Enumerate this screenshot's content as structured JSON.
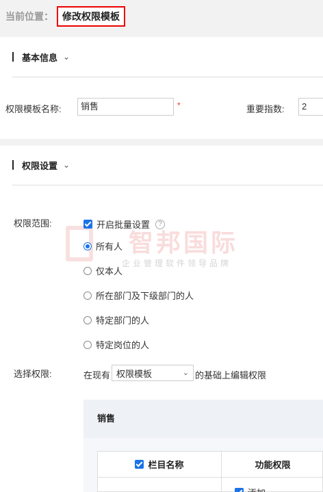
{
  "breadcrumb": {
    "prefix": "当前位置：",
    "current": "修改权限模板"
  },
  "basic_info": {
    "title": "基本信息",
    "name_label": "权限模板名称:",
    "name_value": "销售",
    "required_mark": "*",
    "priority_label": "重要指数:",
    "priority_value": "2"
  },
  "permission_settings": {
    "title": "权限设置",
    "scope_label": "权限范围:",
    "bulk_label": "开启批量设置",
    "help_glyph": "?",
    "options": [
      "所有人",
      "仅本人",
      "所在部门及下级部门的人",
      "特定部门的人",
      "特定岗位的人"
    ],
    "selected_option": "所有人",
    "select_perm_label": "选择权限:",
    "based_on_prefix": "在现有",
    "template_select_value": "权限模板",
    "based_on_suffix": "的基础上编辑权限"
  },
  "watermark": {
    "brand": "智邦国际",
    "slogan": "企业管理软件领导品牌"
  },
  "panel": {
    "title": "销售",
    "col_name": "栏目名称",
    "col_func": "功能权限",
    "first_func_item": "添加"
  },
  "colors": {
    "accent": "#1a73e8",
    "highlight_border": "#e00000",
    "required": "#e33333"
  }
}
